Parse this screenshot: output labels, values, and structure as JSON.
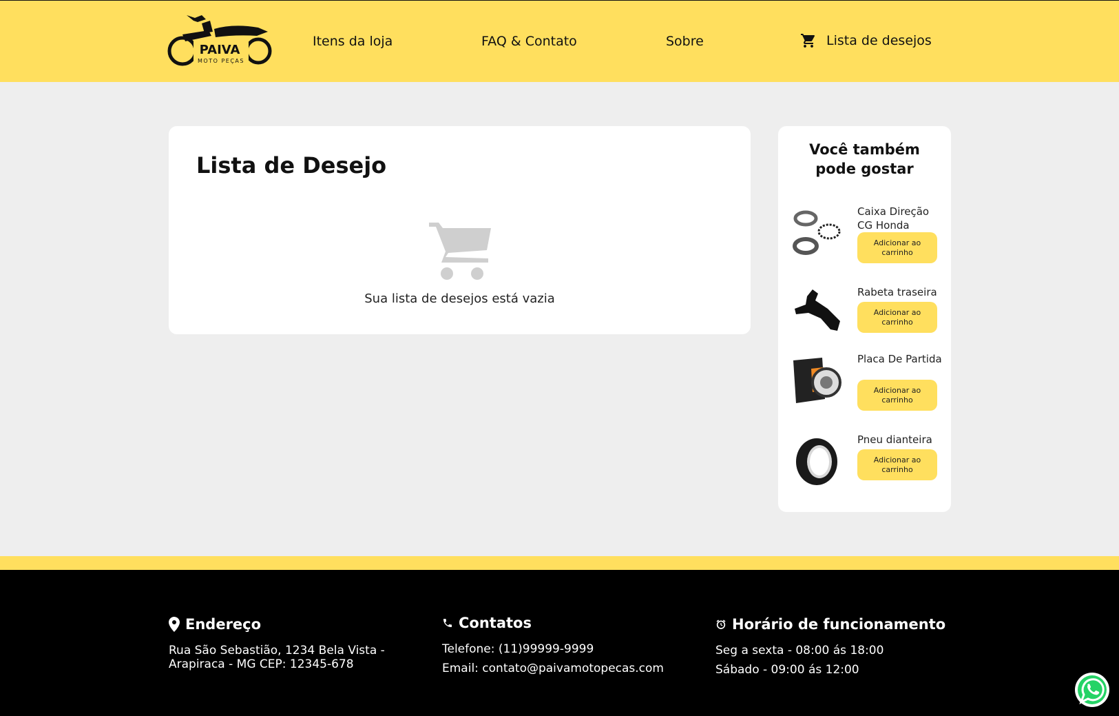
{
  "header": {
    "logo": {
      "text": "PAIVA",
      "subtext": "MOTO PEÇAS"
    },
    "nav": {
      "items_label": "Itens da loja",
      "faq_label": "FAQ & Contato",
      "about_label": "Sobre",
      "wishlist_label": "Lista de desejos"
    }
  },
  "wishlist": {
    "title": "Lista de Desejo",
    "empty_text": "Sua lista de desejos está vazia"
  },
  "sidebar": {
    "title": "Você também pode gostar",
    "products": [
      {
        "name": "Caixa Direção CG Honda",
        "button": "Adicionar ao carrinho"
      },
      {
        "name": "Rabeta traseira",
        "button": "Adicionar ao carrinho"
      },
      {
        "name": "Placa De Partida",
        "button": "Adicionar ao carrinho"
      },
      {
        "name": "Pneu dianteira",
        "button": "Adicionar ao carrinho"
      }
    ]
  },
  "footer": {
    "address": {
      "title": "Endereço",
      "text": "Rua São Sebastião, 1234 Bela Vista - Arapiraca - MG CEP: 12345-678"
    },
    "contacts": {
      "title": "Contatos",
      "phone": "Telefone: (11)99999-9999",
      "email": "Email: contato@paivamotopecas.com"
    },
    "hours": {
      "title": "Horário de funcionamento",
      "weekdays": "Seg a sexta - 08:00 ás 18:00",
      "saturday": "Sábado - 09:00 ás 12:00"
    }
  },
  "colors": {
    "accent": "#ffdf5e",
    "background": "#eeeeee",
    "footer": "#000000"
  }
}
